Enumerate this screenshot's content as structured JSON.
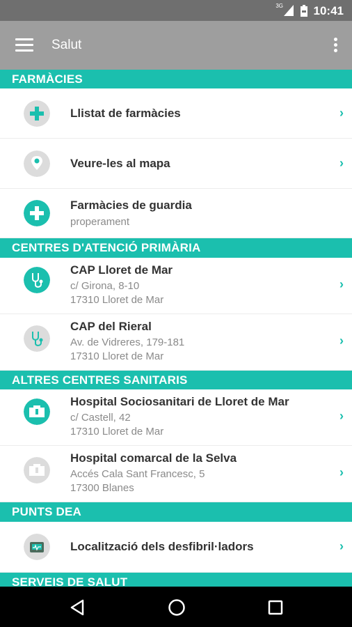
{
  "status_bar": {
    "time": "10:41",
    "network": "3G"
  },
  "toolbar": {
    "title": "Salut"
  },
  "sections": [
    {
      "header": "FARMÀCIES",
      "items": [
        {
          "title": "Llistat de farmàcies"
        },
        {
          "title": "Veure-les al mapa"
        },
        {
          "title": "Farmàcies de guardia",
          "sub": "properament"
        }
      ]
    },
    {
      "header": "CENTRES D'ATENCIÓ PRIMÀRIA",
      "items": [
        {
          "title": "CAP Lloret de Mar",
          "line1": "c/ Girona, 8-10",
          "line2": "17310 Lloret de Mar"
        },
        {
          "title": "CAP del Rieral",
          "line1": "Av. de Vidreres, 179-181",
          "line2": "17310 Lloret de Mar"
        }
      ]
    },
    {
      "header": "ALTRES CENTRES SANITARIS",
      "items": [
        {
          "title": "Hospital Sociosanitari de Lloret de Mar",
          "line1": "c/ Castell, 42",
          "line2": "17310 Lloret de Mar"
        },
        {
          "title": "Hospital comarcal de la Selva",
          "line1": "Accés Cala Sant Francesc, 5",
          "line2": "17300 Blanes"
        }
      ]
    },
    {
      "header": "PUNTS DEA",
      "items": [
        {
          "title": "Localització dels desfibril·ladors"
        }
      ]
    },
    {
      "header": "SERVEIS DE SALUT"
    }
  ],
  "colors": {
    "accent": "#1bbfae",
    "toolbar": "#9e9e9e",
    "statusbar": "#6f6f6f",
    "icon_grey": "#dcdcdc"
  },
  "icons": {
    "menu": "menu-icon",
    "overflow": "overflow-icon",
    "back": "back-icon",
    "home": "home-icon",
    "recents": "recents-icon"
  }
}
